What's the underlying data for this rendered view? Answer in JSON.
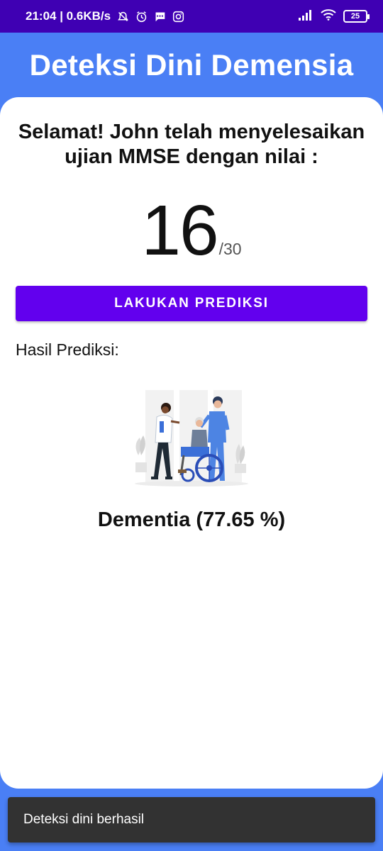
{
  "status_bar": {
    "time_speed": "21:04 | 0.6KB/s",
    "battery": "25",
    "icons": [
      "mute-bell-icon",
      "alarm-icon",
      "message-icon",
      "instagram-icon",
      "signal-icon",
      "wifi-icon",
      "battery-icon"
    ]
  },
  "app_bar": {
    "title": "Deteksi Dini Demensia"
  },
  "main": {
    "headline_line1": "Selamat! John telah menyelesaikan",
    "headline_line2": "ujian MMSE dengan nilai :",
    "score": "16",
    "score_max": "/30",
    "predict_button": "LAKUKAN PREDIKSI",
    "result_label": "Hasil Prediksi:",
    "result_value": "Dementia (77.65 %)",
    "illustration": "caregiver-with-wheelchair-illustration"
  },
  "snackbar": {
    "message": "Deteksi dini berhasil"
  },
  "colors": {
    "status_bar": "#3f00b3",
    "app_bar": "#4a7ff5",
    "button": "#6200ee",
    "snackbar": "#323232"
  }
}
